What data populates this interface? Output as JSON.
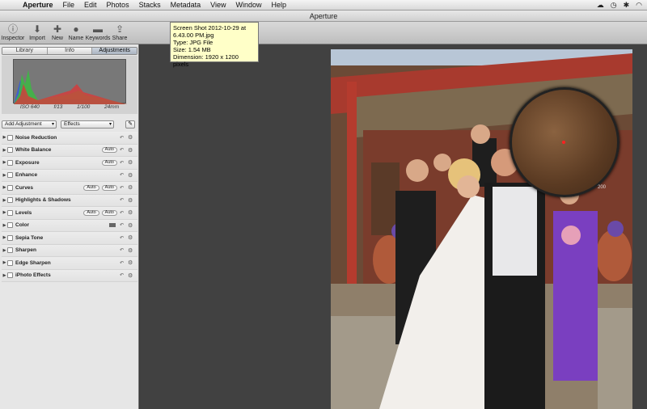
{
  "menubar": {
    "items": [
      "Aperture",
      "File",
      "Edit",
      "Photos",
      "Stacks",
      "Metadata",
      "View",
      "Window",
      "Help"
    ]
  },
  "window": {
    "title": "Aperture"
  },
  "toolbar": {
    "inspector": "Inspector",
    "import": "Import",
    "new": "New",
    "name": "Name",
    "keywords": "Keywords",
    "share": "Share"
  },
  "tooltip": {
    "line1": "Screen Shot 2012-10-29 at",
    "line2": "6.43.00 PM.jpg",
    "line3": "Type: JPG File",
    "line4": "Size: 1.54 MB",
    "line5": "Dimension: 1920 x 1200 pixels"
  },
  "tabs": [
    "Library",
    "Info",
    "Adjustments"
  ],
  "histogram": {
    "iso": "ISO 640",
    "aperture": "f/13",
    "shutter": "1/100",
    "focal": "24mm"
  },
  "add_adjustment": "Add Adjustment",
  "effects": "Effects",
  "adjustments": [
    {
      "label": "Noise Reduction",
      "auto": ""
    },
    {
      "label": "White Balance",
      "auto": "Auto"
    },
    {
      "label": "Exposure",
      "auto": "Auto"
    },
    {
      "label": "Enhance",
      "auto": ""
    },
    {
      "label": "Curves",
      "auto": "Auto",
      "auto2": "Auto"
    },
    {
      "label": "Highlights & Shadows",
      "auto": ""
    },
    {
      "label": "Levels",
      "auto": "Auto",
      "auto2": "Auto"
    },
    {
      "label": "Color",
      "auto": ""
    },
    {
      "label": "Sepia Tone",
      "auto": ""
    },
    {
      "label": "Sharpen",
      "auto": ""
    },
    {
      "label": "Edge Sharpen",
      "auto": ""
    },
    {
      "label": "iPhoto Effects",
      "auto": ""
    }
  ],
  "loupe": {
    "zoom": "200"
  }
}
